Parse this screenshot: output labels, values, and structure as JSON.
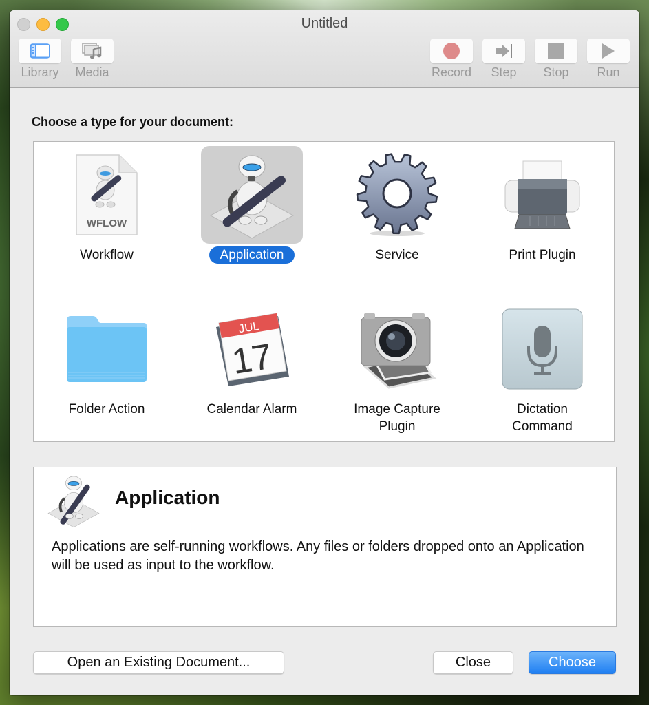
{
  "window": {
    "title": "Untitled"
  },
  "toolbar": {
    "left": [
      {
        "label": "Library",
        "icon": "library-sidebar-icon"
      },
      {
        "label": "Media",
        "icon": "media-icon"
      }
    ],
    "right": [
      {
        "label": "Record",
        "icon": "record-icon"
      },
      {
        "label": "Step",
        "icon": "step-icon"
      },
      {
        "label": "Stop",
        "icon": "stop-icon"
      },
      {
        "label": "Run",
        "icon": "run-icon"
      }
    ]
  },
  "chooser": {
    "prompt": "Choose a type for your document:",
    "selected": "Application",
    "types": [
      {
        "label": "Workflow",
        "icon": "workflow-document-icon",
        "badge": "WFLOW"
      },
      {
        "label": "Application",
        "icon": "automator-robot-icon"
      },
      {
        "label": "Service",
        "icon": "gear-icon"
      },
      {
        "label": "Print Plugin",
        "icon": "printer-icon"
      },
      {
        "label": "Folder Action",
        "icon": "folder-icon"
      },
      {
        "label": "Calendar Alarm",
        "icon": "calendar-icon",
        "month": "JUL",
        "day": "17"
      },
      {
        "label": "Image Capture\nPlugin",
        "icon": "camera-icon"
      },
      {
        "label": "Dictation\nCommand",
        "icon": "microphone-icon"
      }
    ]
  },
  "description": {
    "title": "Application",
    "text": "Applications are self-running workflows. Any files or folders dropped onto an Application will be used as input to the workflow."
  },
  "buttons": {
    "open_existing": "Open an Existing Document...",
    "close": "Close",
    "choose": "Choose"
  },
  "colors": {
    "accent": "#1a6fd9",
    "primary_button": "#1f7ff2",
    "record": "#de8a8a"
  }
}
